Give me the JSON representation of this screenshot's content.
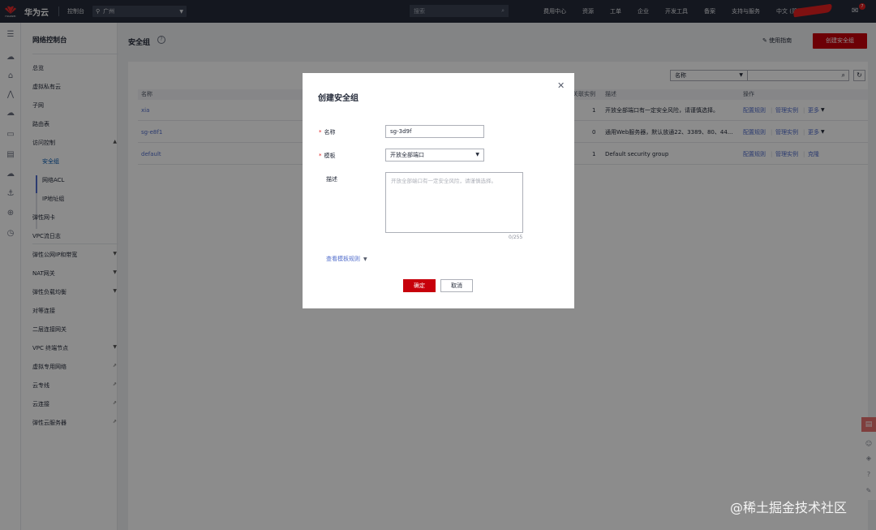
{
  "topbar": {
    "logo_text": "HUAWEI",
    "brand": "华为云",
    "console": "控制台",
    "region": "广州",
    "search_placeholder": "搜索",
    "links": [
      "费用中心",
      "资源",
      "工单",
      "企业",
      "开发工具",
      "备案",
      "支持与服务",
      "中文 (简体)"
    ],
    "message_badge": "7"
  },
  "sidemenu": {
    "title": "网络控制台",
    "items": [
      {
        "label": "总览"
      },
      {
        "label": "虚拟私有云"
      },
      {
        "label": "子网"
      },
      {
        "label": "路由表"
      },
      {
        "label": "访问控制",
        "arrow": "▲"
      },
      {
        "label": "安全组"
      },
      {
        "label": "网络ACL"
      },
      {
        "label": "IP地址组"
      },
      {
        "label": "弹性网卡"
      },
      {
        "label": "VPC流日志"
      },
      {
        "label": "弹性公网IP和带宽",
        "arrow": "▼"
      },
      {
        "label": "NAT网关",
        "arrow": "▼"
      },
      {
        "label": "弹性负载均衡",
        "arrow": "▼"
      },
      {
        "label": "对等连接"
      },
      {
        "label": "二层连接网关"
      },
      {
        "label": "VPC 终端节点",
        "arrow": "▼"
      },
      {
        "label": "虚拟专用网络",
        "arrow": "⇗"
      },
      {
        "label": "云专线",
        "arrow": "⇗"
      },
      {
        "label": "云连接",
        "arrow": "⇗"
      },
      {
        "label": "弹性云服务器",
        "arrow": "⇗"
      }
    ]
  },
  "page": {
    "title": "安全组",
    "guide": "使用指南",
    "create_button": "创建安全组",
    "filter_field": "名称",
    "columns": [
      "名称",
      "关联实例",
      "描述",
      "操作"
    ],
    "rows": [
      {
        "name": "xia",
        "count": "1",
        "desc": "开放全部端口有一定安全风险，请谨慎选择。",
        "ops": [
          "配置规则",
          "管理实例",
          "更多"
        ]
      },
      {
        "name": "sg-e8f1",
        "count": "0",
        "desc": "通用Web服务器，默认放通22、3389、80、44...",
        "ops": [
          "配置规则",
          "管理实例",
          "更多"
        ]
      },
      {
        "name": "default",
        "count": "1",
        "desc": "Default security group",
        "ops": [
          "配置规则",
          "管理实例",
          "克隆"
        ]
      }
    ]
  },
  "dialog": {
    "title": "创建安全组",
    "name_label": "名称",
    "name_value": "sg-3d9f",
    "template_label": "模板",
    "template_value": "开放全部端口",
    "desc_label": "描述",
    "desc_placeholder": "开放全部端口有一定安全风险，请谨慎选择。",
    "desc_count": "0/255",
    "view_rules": "查看模板规则",
    "ok": "确定",
    "cancel": "取消"
  },
  "watermark": "@稀土掘金技术社区"
}
